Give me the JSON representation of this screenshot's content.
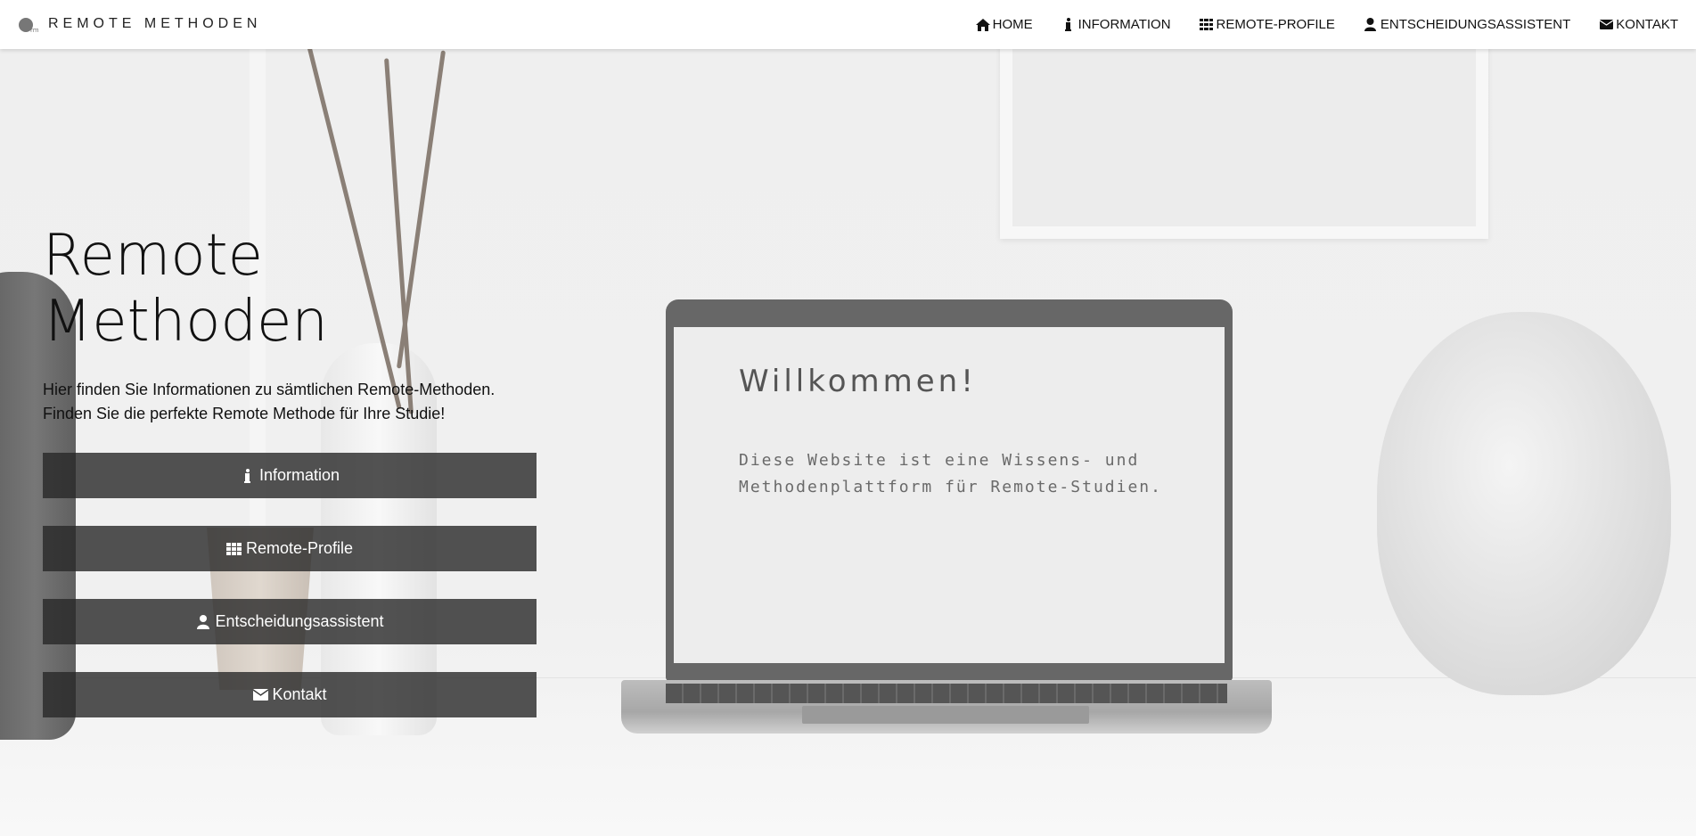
{
  "brand": {
    "name": "REMOTE METHODEN",
    "logo_icon": "logo-icon"
  },
  "nav": {
    "items": [
      {
        "label": "HOME",
        "icon": "home-icon"
      },
      {
        "label": "INFORMATION",
        "icon": "info-icon"
      },
      {
        "label": "REMOTE-PROFILE",
        "icon": "grid-icon"
      },
      {
        "label": "ENTSCHEIDUNGSASSISTENT",
        "icon": "user-icon"
      },
      {
        "label": "KONTAKT",
        "icon": "envelope-icon"
      }
    ]
  },
  "hero": {
    "title": "Remote Methoden",
    "text_line1": "Hier finden Sie Informationen zu sämtlichen Remote-Methoden.",
    "text_line2": "Finden Sie die perfekte Remote Methode für Ihre Studie!",
    "buttons": [
      {
        "label": "Information",
        "icon": "info-icon"
      },
      {
        "label": "Remote-Profile",
        "icon": "grid-icon"
      },
      {
        "label": "Entscheidungsassistent",
        "icon": "user-icon"
      },
      {
        "label": "Kontakt",
        "icon": "envelope-icon"
      }
    ]
  },
  "laptop_screen": {
    "title": "Willkommen!",
    "text": "Diese Website ist eine Wissens- und\nMethodenplattform für Remote-Studien."
  },
  "colors": {
    "button_bg": "#3b3b3b",
    "nav_bg": "#ffffff",
    "text": "#111111"
  }
}
